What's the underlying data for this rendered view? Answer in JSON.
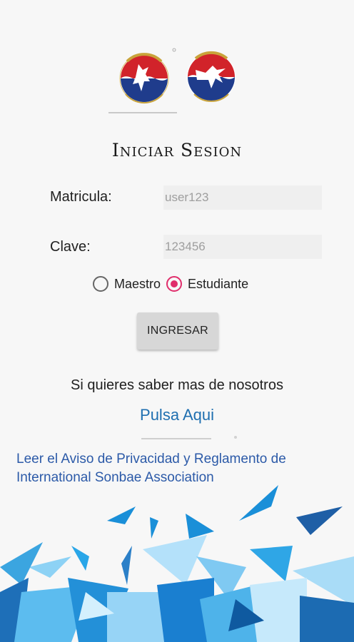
{
  "title": "Iniciar Sesion",
  "form": {
    "matricula_label": "Matricula:",
    "matricula_value": "user123",
    "clave_label": "Clave:",
    "clave_value": "123456"
  },
  "role": {
    "options": [
      "Maestro",
      "Estudiante"
    ],
    "selected": "Estudiante"
  },
  "submit_label": "INGRESAR",
  "info_text": "Si quieres saber mas de nosotros",
  "more_link": "Pulsa Aqui",
  "privacy": {
    "line1": "Leer el Aviso de Privacidad y Reglamento de",
    "line2": "International Sonbae Association"
  },
  "colors": {
    "accent": "#e02d6b",
    "link": "#1f6fb0",
    "privacy_link": "#2c5aa8",
    "background": "#f7f7f7"
  }
}
